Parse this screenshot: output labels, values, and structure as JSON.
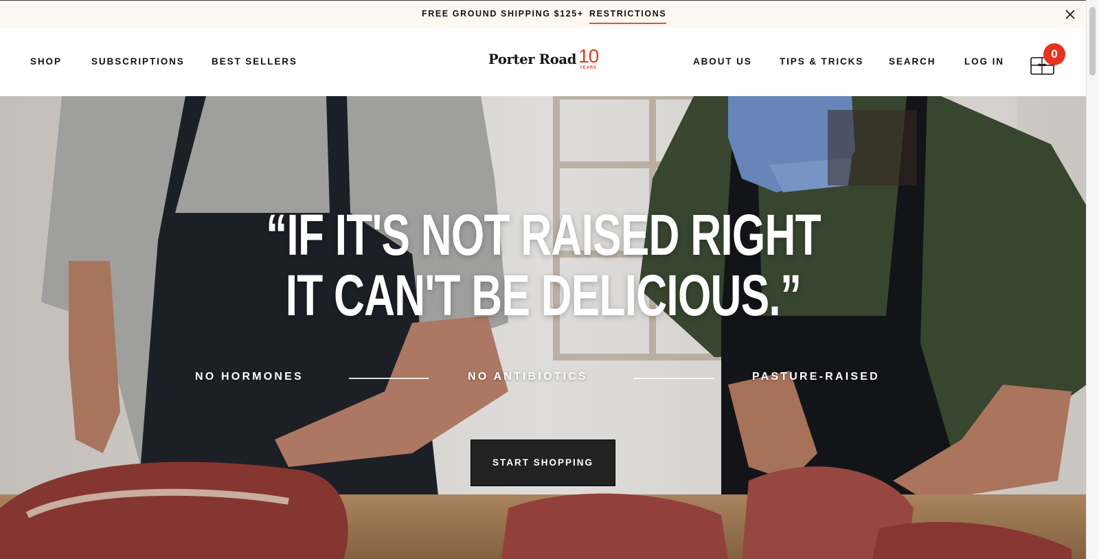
{
  "announcement": {
    "text": "FREE GROUND SHIPPING $125+",
    "link": "RESTRICTIONS"
  },
  "nav": {
    "left": [
      "SHOP",
      "SUBSCRIPTIONS",
      "BEST SELLERS"
    ],
    "right": [
      "ABOUT US",
      "TIPS & TRICKS",
      "SEARCH",
      "LOG IN"
    ]
  },
  "logo": {
    "name": "Porter Road",
    "number": "10",
    "sub": "YEARS"
  },
  "cart": {
    "count": "0",
    "icon": "gift-box-cart-icon"
  },
  "hero": {
    "quote_line1": "“IF IT'S NOT RAISED RIGHT",
    "quote_line2": "IT CAN'T BE DELICIOUS.”",
    "badges": [
      "NO HORMONES",
      "NO ANTIBIOTICS",
      "PASTURE-RAISED"
    ],
    "cta": "START SHOPPING"
  },
  "colors": {
    "accent": "#e8321f",
    "announce_bg": "#fdf8f2",
    "cta_bg": "#222222"
  }
}
